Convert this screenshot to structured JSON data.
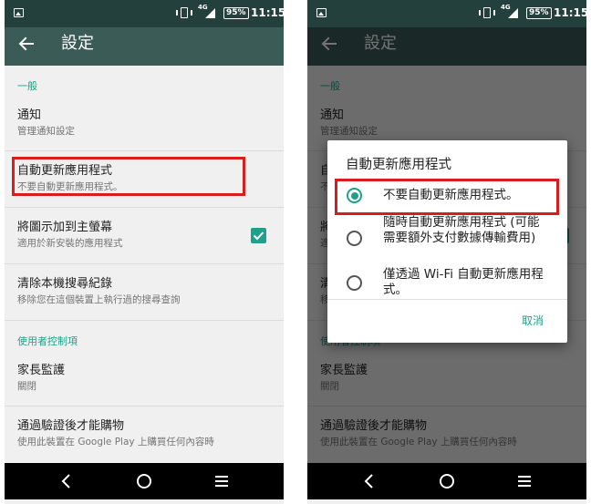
{
  "colors": {
    "status_bar": "#24403d",
    "toolbar": "#3b5b57",
    "accent": "#20a08a",
    "background": "#f0f0f0",
    "highlight": "#d91c1c"
  },
  "status_bar": {
    "network": "4G",
    "battery": "95%",
    "time": "11:15"
  },
  "toolbar": {
    "title": "設定",
    "back_icon": "arrow-left-icon"
  },
  "settings": {
    "section_general": "一般",
    "notifications": {
      "title": "通知",
      "summary": "管理通知設定"
    },
    "auto_update": {
      "title": "自動更新應用程式",
      "summary": "不要自動更新應用程式。"
    },
    "add_icon": {
      "title": "將圖示加到主螢幕",
      "summary": "適用於新安裝的應用程式",
      "checked": true
    },
    "clear_history": {
      "title": "清除本機搜尋紀錄",
      "summary": "移除您在這個裝置上執行過的搜尋查詢"
    },
    "section_user_controls": "使用者控制項",
    "parental": {
      "title": "家長監護",
      "summary": "關閉"
    },
    "auth_purchase": {
      "title": "通過驗證後才能購物",
      "summary": "使用此裝置在 Google Play 上購買任何內容時"
    }
  },
  "dialog": {
    "title": "自動更新應用程式",
    "options": [
      {
        "label": "不要自動更新應用程式。",
        "selected": true
      },
      {
        "label": "隨時自動更新應用程式 (可能需要額外支付數據傳輸費用)",
        "selected": false
      },
      {
        "label": "僅透過 Wi-Fi 自動更新應用程式。",
        "selected": false
      }
    ],
    "cancel_label": "取消"
  },
  "nav_bar": {
    "icons": [
      "back-triangle-icon",
      "home-circle-icon",
      "menu-lines-icon"
    ]
  }
}
